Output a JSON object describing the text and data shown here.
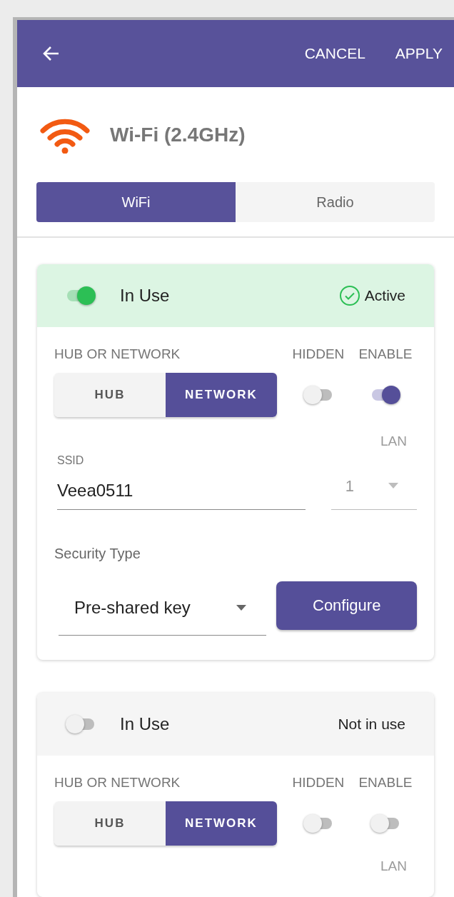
{
  "header": {
    "cancel": "CANCEL",
    "apply": "APPLY"
  },
  "title": "Wi-Fi (2.4GHz)",
  "tabs": [
    {
      "label": "WiFi",
      "selected": true
    },
    {
      "label": "Radio",
      "selected": false
    }
  ],
  "networks": [
    {
      "in_use": {
        "label": "In Use",
        "on": true
      },
      "status": {
        "label": "Active",
        "kind": "active"
      },
      "mode_label": "HUB OR NETWORK",
      "modes": [
        {
          "label": "HUB",
          "selected": false
        },
        {
          "label": "NETWORK",
          "selected": true
        }
      ],
      "hidden": {
        "label": "HIDDEN",
        "on": false
      },
      "enable": {
        "label": "ENABLE",
        "on": true
      },
      "lan": {
        "label": "LAN",
        "value": "1",
        "disabled": true
      },
      "ssid": {
        "label": "SSID",
        "value": "Veea0511"
      },
      "security": {
        "label": "Security Type",
        "value": "Pre-shared key"
      },
      "configure": "Configure"
    },
    {
      "in_use": {
        "label": "In Use",
        "on": false
      },
      "status": {
        "label": "Not in use",
        "kind": "inactive"
      },
      "mode_label": "HUB OR NETWORK",
      "modes": [
        {
          "label": "HUB",
          "selected": false
        },
        {
          "label": "NETWORK",
          "selected": true
        }
      ],
      "hidden": {
        "label": "HIDDEN",
        "on": false
      },
      "enable": {
        "label": "ENABLE",
        "on": false
      },
      "lan": {
        "label": "LAN",
        "disabled": true
      }
    }
  ]
}
